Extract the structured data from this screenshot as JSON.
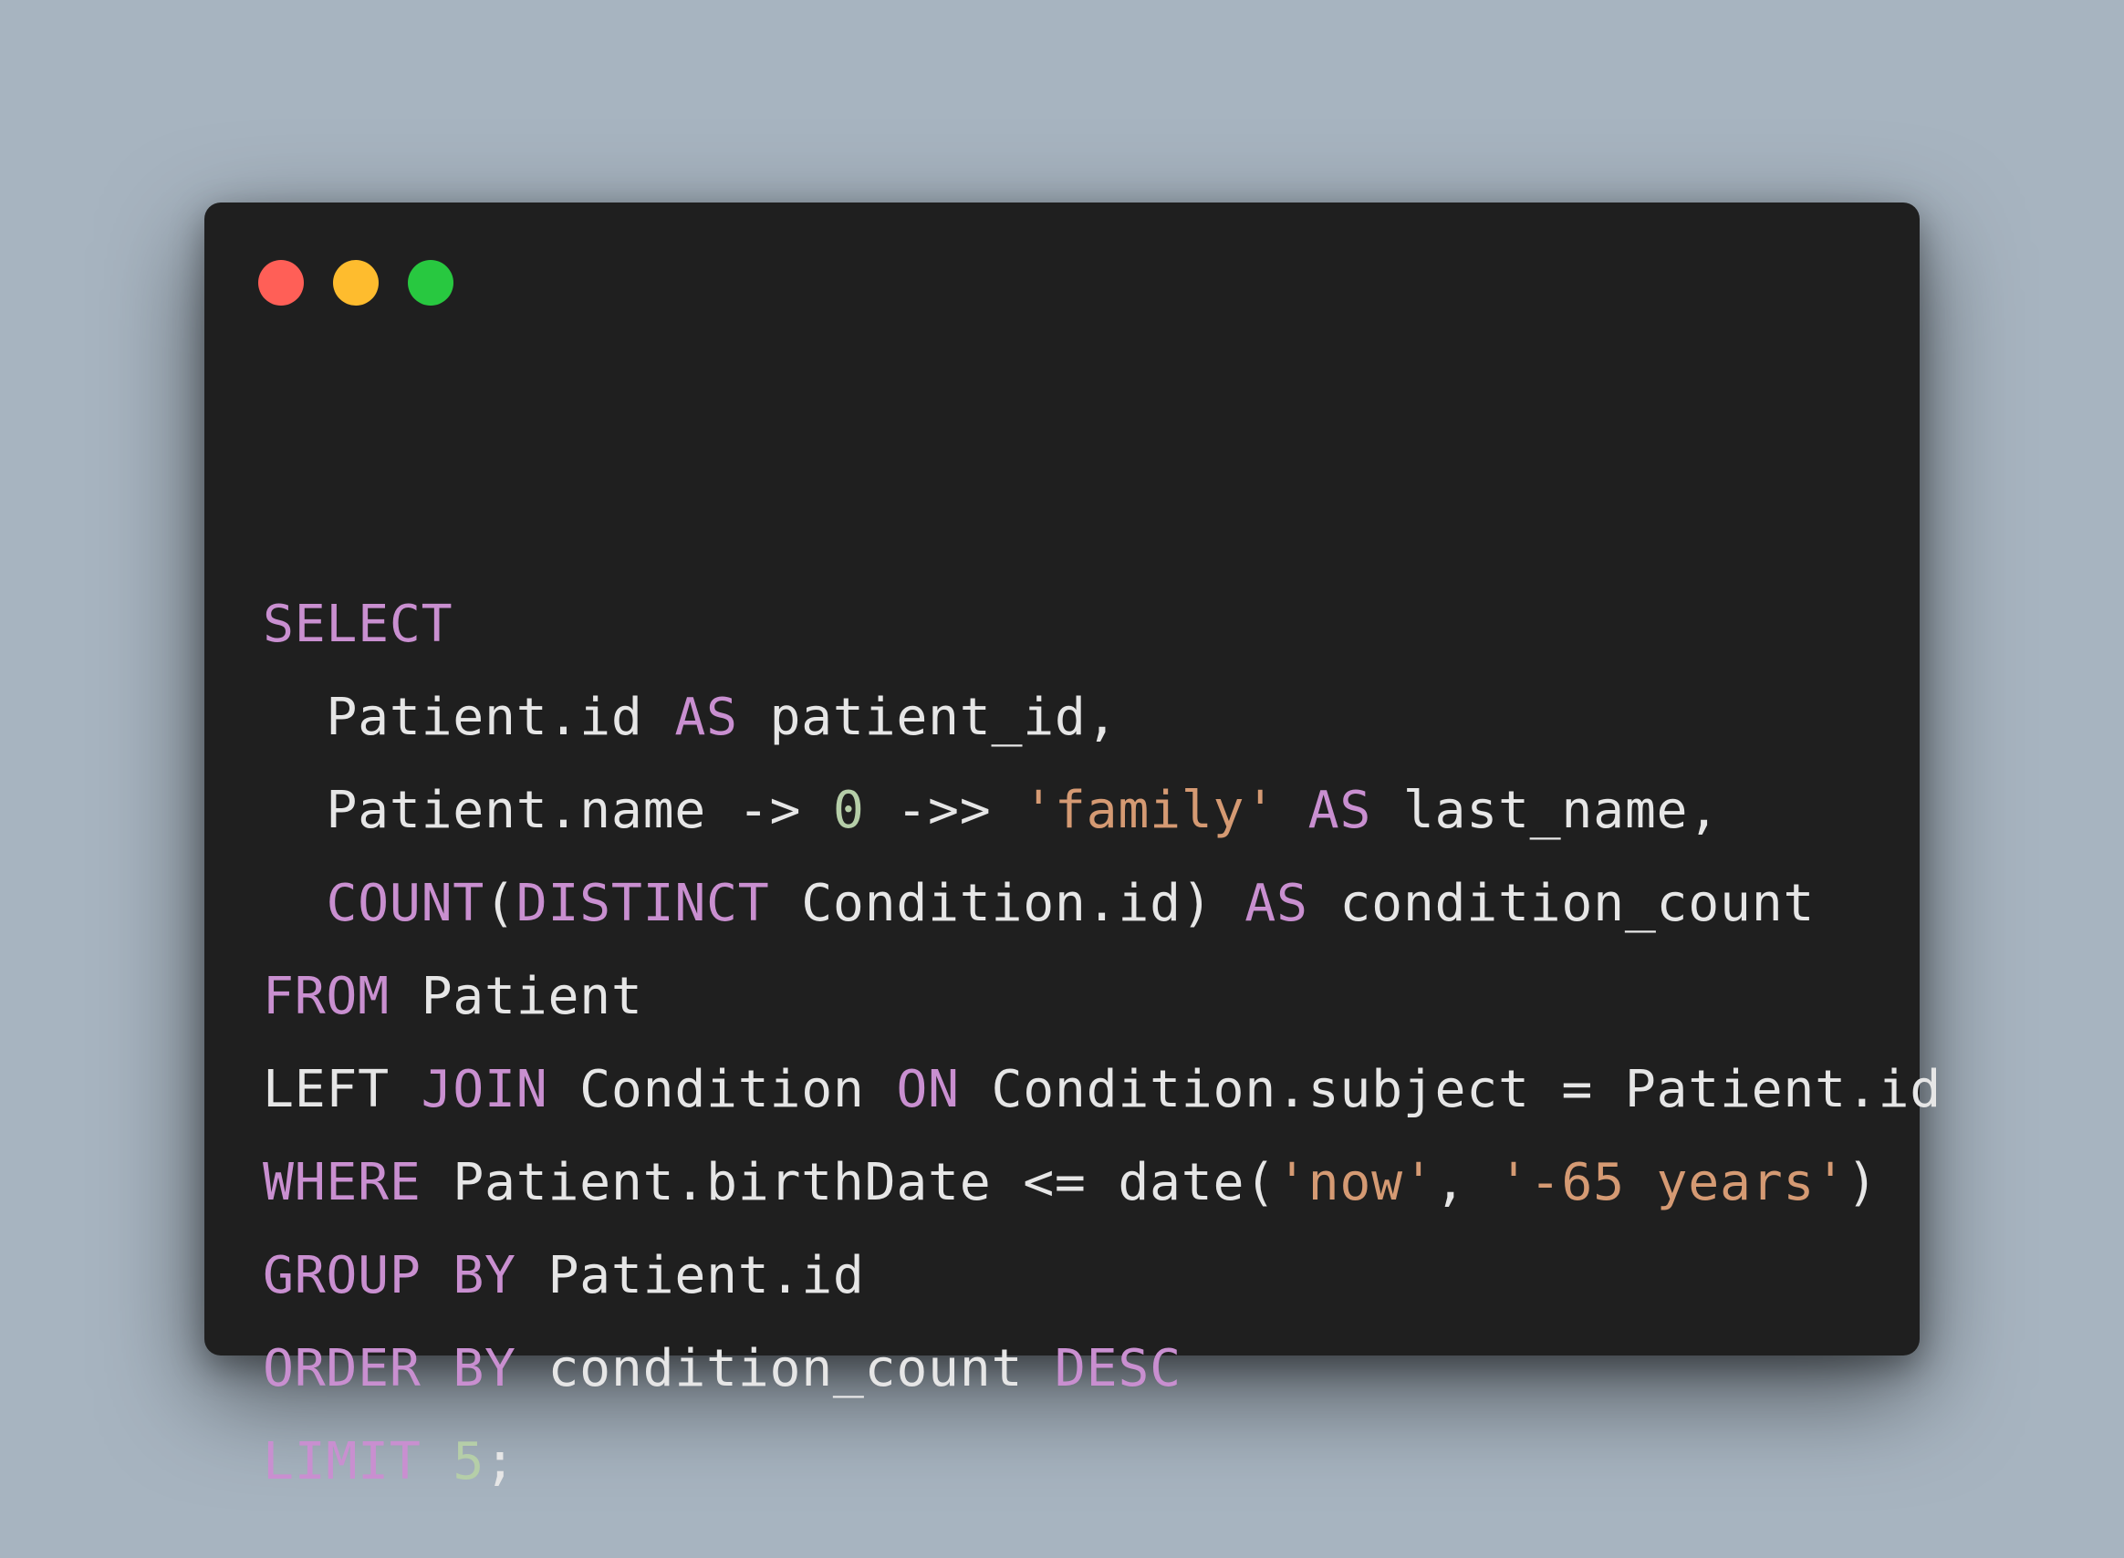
{
  "window": {
    "controls": [
      {
        "name": "close-button",
        "color": "#ff5f57"
      },
      {
        "name": "minimize-button",
        "color": "#febc2e"
      },
      {
        "name": "maximize-button",
        "color": "#28c840"
      }
    ]
  },
  "colors": {
    "background": "#a7b4c0",
    "window": "#1f1f1f",
    "keyword": "#c98fd0",
    "identifier": "#e6e6e6",
    "string": "#d59a73",
    "number": "#b5cea8"
  },
  "code": {
    "language": "SQL",
    "lines": [
      [
        {
          "t": "SELECT",
          "c": "kw"
        }
      ],
      [
        {
          "t": "  Patient.id ",
          "c": "id"
        },
        {
          "t": "AS",
          "c": "kw"
        },
        {
          "t": " patient_id,",
          "c": "id"
        }
      ],
      [
        {
          "t": "  Patient.name -> ",
          "c": "id"
        },
        {
          "t": "0",
          "c": "num"
        },
        {
          "t": " ->> ",
          "c": "id"
        },
        {
          "t": "'family'",
          "c": "str"
        },
        {
          "t": " ",
          "c": "id"
        },
        {
          "t": "AS",
          "c": "kw"
        },
        {
          "t": " last_name,",
          "c": "id"
        }
      ],
      [
        {
          "t": "  ",
          "c": "id"
        },
        {
          "t": "COUNT",
          "c": "kw"
        },
        {
          "t": "(",
          "c": "id"
        },
        {
          "t": "DISTINCT",
          "c": "kw"
        },
        {
          "t": " Condition.id) ",
          "c": "id"
        },
        {
          "t": "AS",
          "c": "kw"
        },
        {
          "t": " condition_count",
          "c": "id"
        }
      ],
      [
        {
          "t": "FROM",
          "c": "kw"
        },
        {
          "t": " Patient",
          "c": "id"
        }
      ],
      [
        {
          "t": "LEFT ",
          "c": "id"
        },
        {
          "t": "JOIN",
          "c": "kw"
        },
        {
          "t": " Condition ",
          "c": "id"
        },
        {
          "t": "ON",
          "c": "kw"
        },
        {
          "t": " Condition.subject = Patient.id",
          "c": "id"
        }
      ],
      [
        {
          "t": "WHERE",
          "c": "kw"
        },
        {
          "t": " Patient.birthDate <= date(",
          "c": "id"
        },
        {
          "t": "'now'",
          "c": "str"
        },
        {
          "t": ", ",
          "c": "id"
        },
        {
          "t": "'-65 years'",
          "c": "str"
        },
        {
          "t": ")",
          "c": "id"
        }
      ],
      [
        {
          "t": "GROUP",
          "c": "kw"
        },
        {
          "t": " ",
          "c": "id"
        },
        {
          "t": "BY",
          "c": "kw"
        },
        {
          "t": " Patient.id",
          "c": "id"
        }
      ],
      [
        {
          "t": "ORDER",
          "c": "kw"
        },
        {
          "t": " ",
          "c": "id"
        },
        {
          "t": "BY",
          "c": "kw"
        },
        {
          "t": " condition_count ",
          "c": "id"
        },
        {
          "t": "DESC",
          "c": "kw"
        }
      ],
      [
        {
          "t": "LIMIT",
          "c": "kw"
        },
        {
          "t": " ",
          "c": "id"
        },
        {
          "t": "5",
          "c": "num"
        },
        {
          "t": ";",
          "c": "id"
        }
      ]
    ]
  }
}
